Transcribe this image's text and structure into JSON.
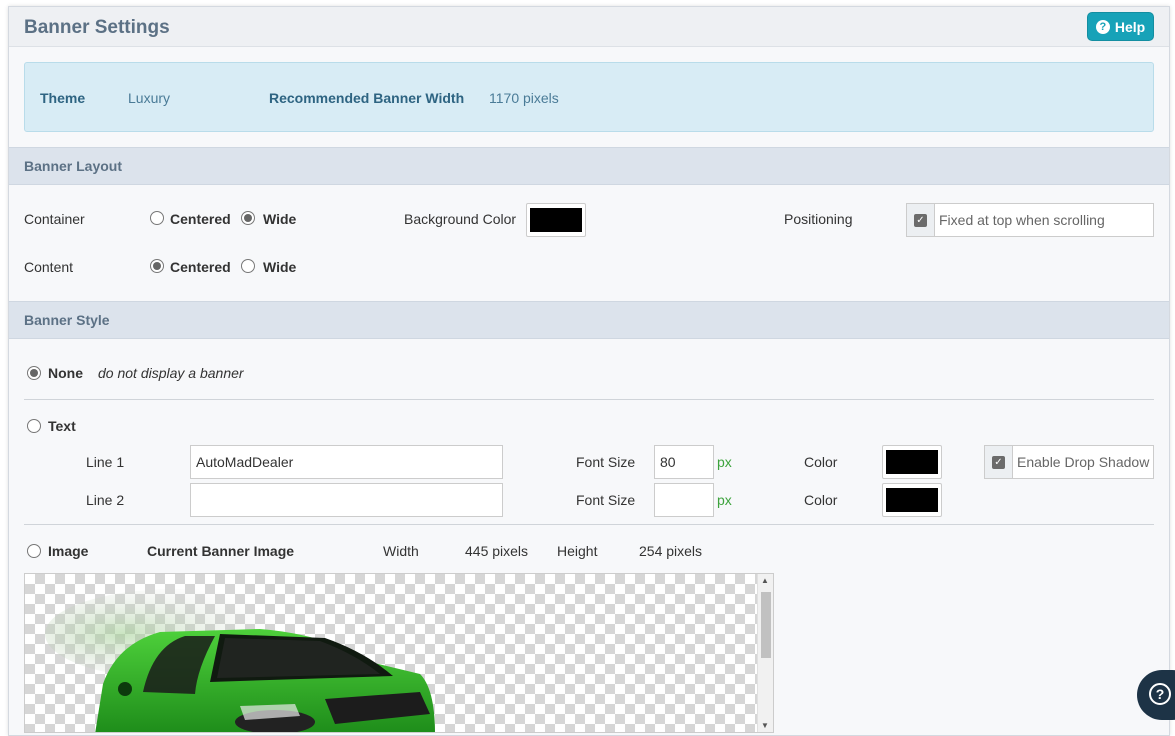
{
  "header": {
    "title": "Banner Settings",
    "help_label": "Help",
    "help_icon": "question-circle-icon"
  },
  "info": {
    "theme_label": "Theme",
    "theme_value": "Luxury",
    "width_label": "Recommended Banner Width",
    "width_value": "1170 pixels"
  },
  "layout": {
    "section_title": "Banner Layout",
    "container_label": "Container",
    "content_label": "Content",
    "centered": "Centered",
    "wide": "Wide",
    "container_selected": "Wide",
    "content_selected": "Centered",
    "bg_color_label": "Background Color",
    "bg_color": "#000000",
    "positioning_label": "Positioning",
    "fixed_label": "Fixed at top when scrolling",
    "fixed_checked": true
  },
  "style": {
    "section_title": "Banner Style",
    "selected": "None",
    "none_label": "None",
    "none_desc": "do not display a banner",
    "text_label": "Text",
    "line1_label": "Line 1",
    "line1_value": "AutoMadDealer",
    "line2_label": "Line 2",
    "line2_value": "",
    "font_size_label": "Font Size",
    "font_size_1": "80",
    "font_size_2": "",
    "px_unit": "px",
    "color_label": "Color",
    "color_1": "#000000",
    "color_2": "#000000",
    "shadow_label": "Enable Drop Shadow",
    "shadow_checked": true,
    "image_label": "Image",
    "current_image_label": "Current Banner Image",
    "width_label": "Width",
    "width_value": "445 pixels",
    "height_label": "Height",
    "height_value": "254 pixels"
  },
  "floating_help": {
    "icon": "question-circle-icon",
    "glyph": "?"
  }
}
